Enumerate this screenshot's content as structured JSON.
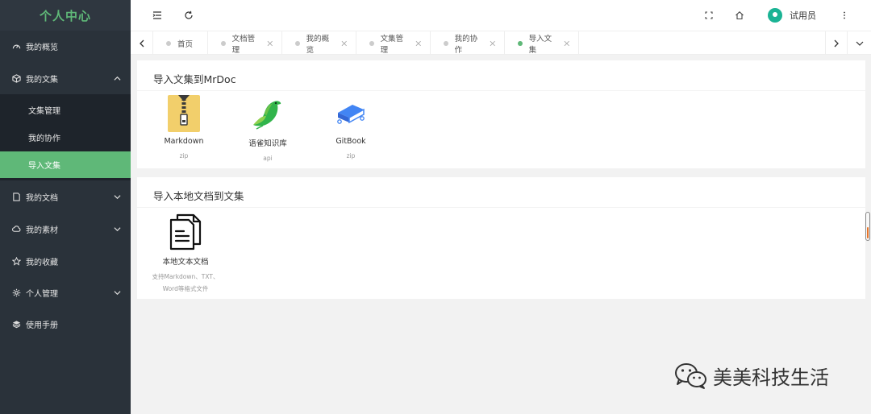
{
  "sidebar": {
    "brand": "个人中心",
    "items": [
      {
        "label": "我的概览"
      },
      {
        "label": "我的文集"
      },
      {
        "label": "我的文档"
      },
      {
        "label": "我的素材"
      },
      {
        "label": "我的收藏"
      },
      {
        "label": "个人管理"
      },
      {
        "label": "使用手册"
      }
    ],
    "submenu": [
      {
        "label": "文集管理"
      },
      {
        "label": "我的协作"
      },
      {
        "label": "导入文集"
      }
    ]
  },
  "header": {
    "user_name": "试用员"
  },
  "tabs": [
    {
      "label": "首页"
    },
    {
      "label": "文档管理"
    },
    {
      "label": "我的概览"
    },
    {
      "label": "文集管理"
    },
    {
      "label": "我的协作"
    },
    {
      "label": "导入文集"
    }
  ],
  "import_collection": {
    "title": "导入文集到MrDoc",
    "items": [
      {
        "name": "Markdown",
        "sub": "zip"
      },
      {
        "name": "语雀知识库",
        "sub": "api"
      },
      {
        "name": "GitBook",
        "sub": "zip"
      }
    ]
  },
  "import_local": {
    "title": "导入本地文档到文集",
    "item": {
      "name": "本地文本文档",
      "sub1": "支持Markdown、TXT、",
      "sub2": "Word等格式文件"
    }
  },
  "watermark": {
    "text": "美美科技生活"
  },
  "colors": {
    "sidebar_bg": "#2a323a",
    "accent": "#5fb878",
    "avatar": "#1ab394"
  }
}
